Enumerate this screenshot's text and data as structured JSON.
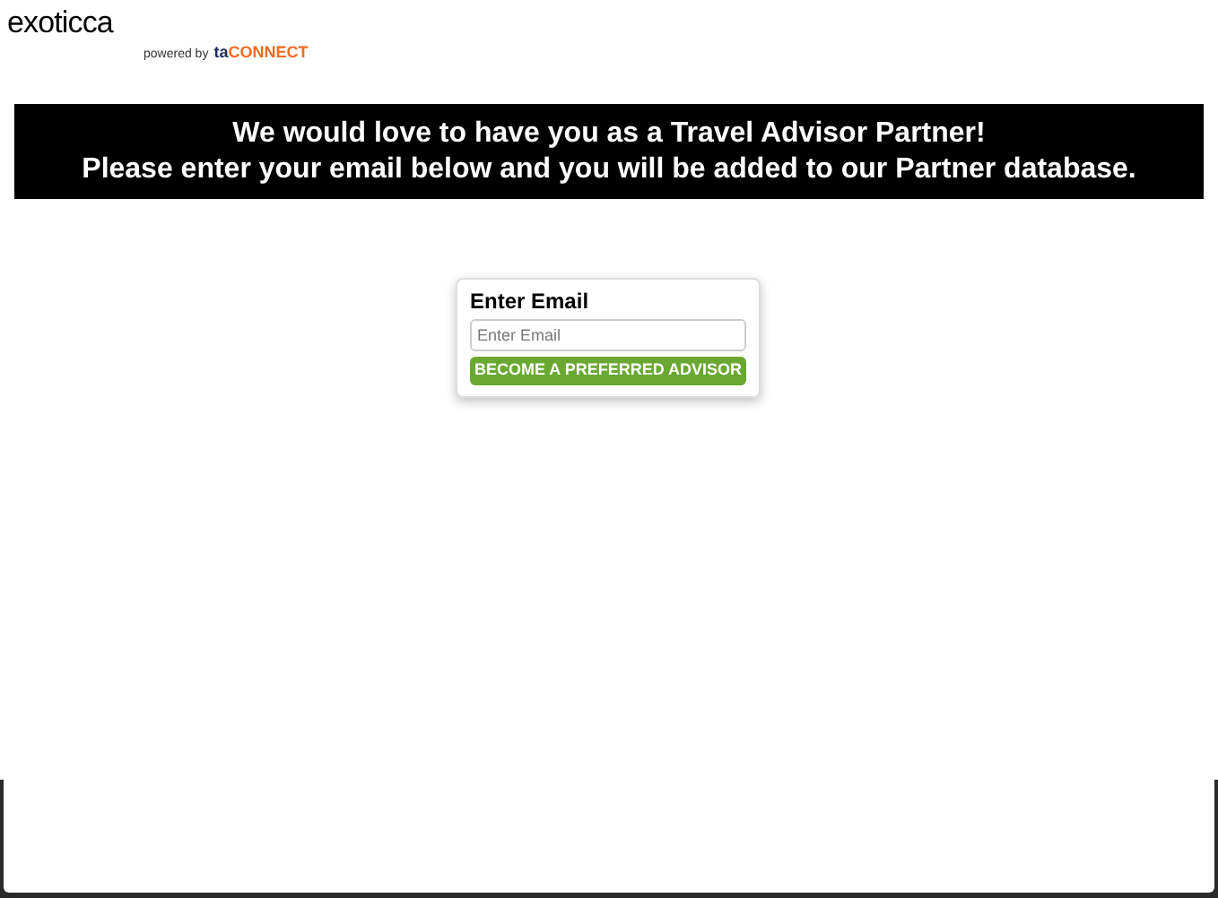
{
  "header": {
    "logo": "exoticca",
    "powered_by": "powered by",
    "partner_logo_prefix": "ta",
    "partner_logo_suffix": "CONNECT"
  },
  "banner": {
    "lines": [
      "We would love to have you as a Travel Advisor Partner!",
      "Please enter your email below and you will be added to our Partner database."
    ]
  },
  "form": {
    "label": "Enter Email",
    "placeholder": "Enter Email",
    "button": "BECOME A PREFERRED ADVISOR"
  }
}
